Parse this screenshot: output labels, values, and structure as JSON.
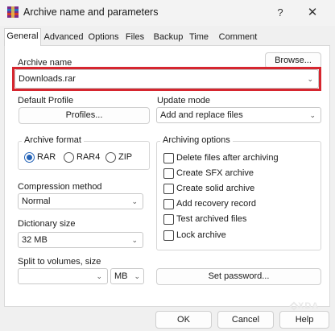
{
  "window": {
    "title": "Archive name and parameters",
    "help_glyph": "?",
    "close_glyph": "✕"
  },
  "tabs": [
    "General",
    "Advanced",
    "Options",
    "Files",
    "Backup",
    "Time",
    "Comment"
  ],
  "general": {
    "archive_name_label": "Archive name",
    "archive_name_value": "Downloads.rar",
    "browse_label": "Browse...",
    "default_profile_label": "Default Profile",
    "profiles_label": "Profiles...",
    "update_mode_label": "Update mode",
    "update_mode_value": "Add and replace files",
    "archive_format_label": "Archive format",
    "formats": [
      "RAR",
      "RAR4",
      "ZIP"
    ],
    "selected_format": "RAR",
    "compression_label": "Compression method",
    "compression_value": "Normal",
    "dictionary_label": "Dictionary size",
    "dictionary_value": "32 MB",
    "split_label": "Split to volumes, size",
    "split_value": "",
    "split_unit": "MB",
    "archiving_options_label": "Archiving options",
    "options": [
      {
        "label": "Delete files after archiving",
        "checked": false
      },
      {
        "label": "Create SFX archive",
        "checked": false
      },
      {
        "label": "Create solid archive",
        "checked": false
      },
      {
        "label": "Add recovery record",
        "checked": false
      },
      {
        "label": "Test archived files",
        "checked": false
      },
      {
        "label": "Lock archive",
        "checked": false
      }
    ],
    "set_password_label": "Set password..."
  },
  "footer": {
    "ok_label": "OK",
    "cancel_label": "Cancel",
    "help_label": "Help"
  },
  "watermark": "XDA",
  "colors": {
    "highlight": "#d6262f",
    "radio_accent": "#2463b7"
  }
}
